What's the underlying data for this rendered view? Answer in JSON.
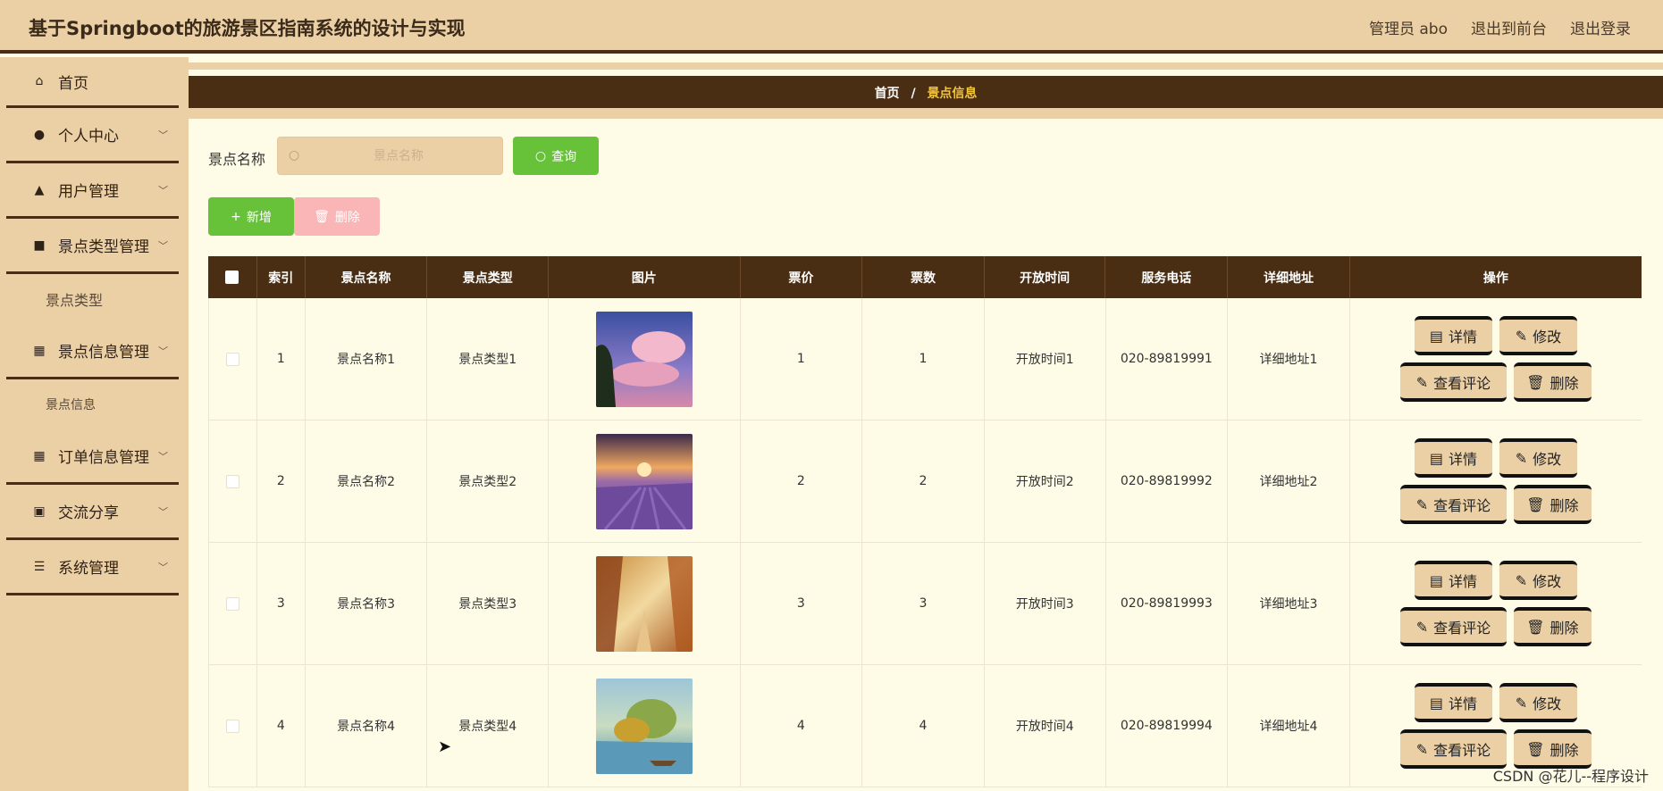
{
  "header": {
    "title": "基于Springboot的旅游景区指南系统的设计与实现",
    "user": "管理员 abo",
    "to_front": "退出到前台",
    "logout": "退出登录"
  },
  "sidebar": {
    "items": [
      {
        "label": "首页",
        "icon": "home-icon"
      },
      {
        "label": "个人中心",
        "icon": "person-icon"
      },
      {
        "label": "用户管理",
        "icon": "user-icon"
      },
      {
        "label": "景点类型管理",
        "icon": "wallet-icon"
      },
      {
        "label": "景点信息管理",
        "icon": "grid-icon"
      },
      {
        "label": "订单信息管理",
        "icon": "grid-icon"
      },
      {
        "label": "交流分享",
        "icon": "clipboard-icon"
      },
      {
        "label": "系统管理",
        "icon": "sliders-icon"
      }
    ],
    "sub": {
      "scenic_type": "景点类型",
      "scenic_info": "景点信息"
    }
  },
  "breadcrumb": {
    "home": "首页",
    "sep": "/",
    "current": "景点信息"
  },
  "search": {
    "label": "景点名称",
    "placeholder": "景点名称",
    "button": "查询"
  },
  "toolbar": {
    "add": "新增",
    "delete": "删除"
  },
  "table": {
    "headers": [
      "索引",
      "景点名称",
      "景点类型",
      "图片",
      "票价",
      "票数",
      "开放时间",
      "服务电话",
      "详细地址",
      "操作"
    ],
    "rows": [
      {
        "index": "1",
        "name": "景点名称1",
        "type": "景点类型1",
        "price": "1",
        "count": "1",
        "time": "开放时间1",
        "phone": "020-89819991",
        "address": "详细地址1"
      },
      {
        "index": "2",
        "name": "景点名称2",
        "type": "景点类型2",
        "price": "2",
        "count": "2",
        "time": "开放时间2",
        "phone": "020-89819992",
        "address": "详细地址2"
      },
      {
        "index": "3",
        "name": "景点名称3",
        "type": "景点类型3",
        "price": "3",
        "count": "3",
        "time": "开放时间3",
        "phone": "020-89819993",
        "address": "详细地址3"
      },
      {
        "index": "4",
        "name": "景点名称4",
        "type": "景点类型4",
        "price": "4",
        "count": "4",
        "time": "开放时间4",
        "phone": "020-89819994",
        "address": "详细地址4"
      }
    ],
    "actions": {
      "detail": "详情",
      "edit": "修改",
      "comments": "查看评论",
      "delete": "删除"
    }
  },
  "watermark": "CSDN @花儿--程序设计",
  "colors": {
    "accent": "#4a2e14",
    "panel": "#ebcfa5",
    "background": "#fefbe6",
    "success": "#67c23a",
    "danger_light": "#fab6b6",
    "highlight": "#f2c33c"
  }
}
